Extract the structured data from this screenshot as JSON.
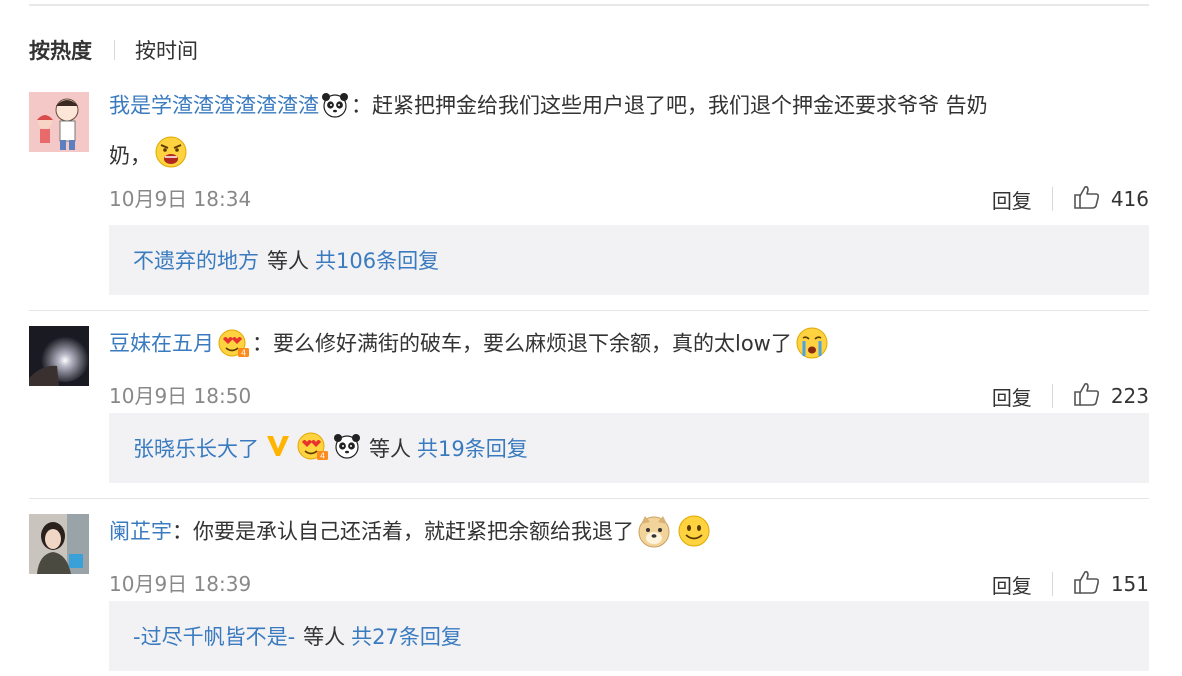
{
  "sort": {
    "active": "按热度",
    "other": "按时间"
  },
  "comments": [
    {
      "user": "我是学渣渣渣渣渣渣渣",
      "line1": "：赶紧把押金给我们这些用户退了吧，我们退个押金还要求爷爷 告奶",
      "line2": "奶，",
      "time": "10月9日 18:34",
      "reply_label": "回复",
      "likes": "416",
      "replies": {
        "names": "不遗弃的地方",
        "suffix": "等人",
        "count": "共106条回复"
      }
    },
    {
      "user": "豆妹在五月",
      "text": "：要么修好满街的破车，要么麻烦退下余额，真的太low了",
      "time": "10月9日 18:50",
      "reply_label": "回复",
      "likes": "223",
      "replies": {
        "names": "张晓乐长大了",
        "suffix": "等人",
        "count": "共19条回复"
      }
    },
    {
      "user": "阑芷宇",
      "text": "：你要是承认自己还活着，就赶紧把余额给我退了",
      "time": "10月9日 18:39",
      "reply_label": "回复",
      "likes": "151",
      "replies": {
        "names": "-过尽千帆皆不是-",
        "suffix": "等人",
        "count": "共27条回复"
      }
    }
  ]
}
